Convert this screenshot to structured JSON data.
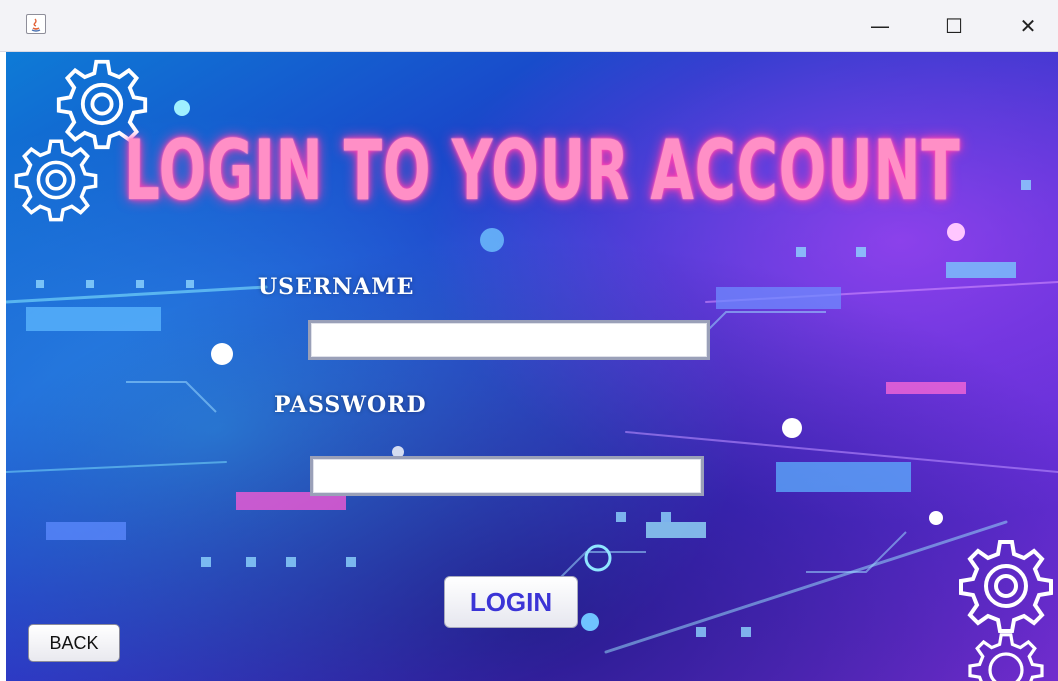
{
  "window": {
    "minimize_glyph": "—",
    "maximize_glyph": "☐",
    "close_glyph": "✕"
  },
  "heading": "LOGIN TO YOUR ACCOUNT",
  "form": {
    "username_label": "USERNAME",
    "username_value": "",
    "password_label": "PASSWORD",
    "password_value": "",
    "login_label": "LOGIN"
  },
  "back_label": "BACK",
  "colors": {
    "heading": "#ff8fc6",
    "login_text": "#3b34d6"
  }
}
